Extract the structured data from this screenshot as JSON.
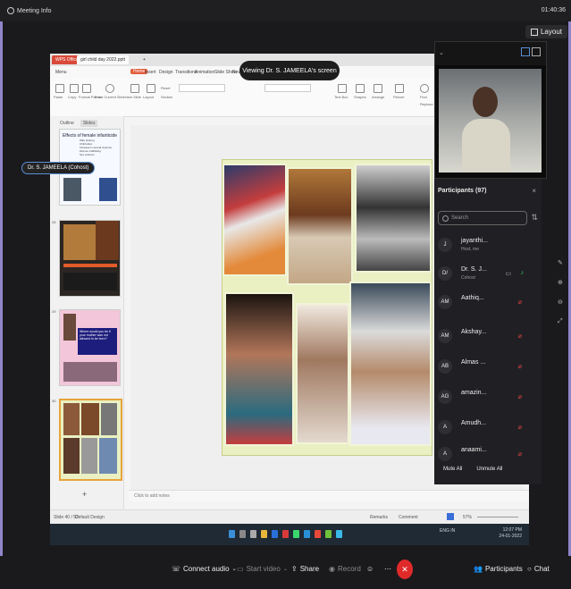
{
  "topbar": {
    "meeting_info": "Meeting Info",
    "time": "01:40:36"
  },
  "layout_button": "Layout",
  "viewing_banner": "Viewing Dr. S. JAMEELA's screen",
  "wps": {
    "tabs": [
      "WPS Office",
      "girl child day 2022.pptt"
    ],
    "menu": [
      "Menu",
      "Home",
      "Insert",
      "Design",
      "Transitions",
      "Animation",
      "Slide Show",
      "Review",
      "View"
    ],
    "ribbon_labels": [
      "Paste",
      "Copy",
      "Format Painter",
      "From Current Slide",
      "New Slide",
      "Layout",
      "Reset",
      "Section",
      "Text Box",
      "Shapes",
      "Arrange",
      "Picture",
      "Find",
      "Replace"
    ],
    "panel_tabs": [
      "Outline",
      "Slides"
    ],
    "thumb1_title": "Effects of female infanticide",
    "thumb1_lines": [
      "Wife sharing",
      "Child labor",
      "Increase in sexual violence",
      "Women trafficking",
      "Sex cultures"
    ],
    "thumb3_text": "Where would you be if your mother was not allowed to be born?",
    "thumb_numbers": [
      "28",
      "29",
      "30"
    ],
    "notes_placeholder": "Click to add notes",
    "status_left": "Slide 40 / 53",
    "status_design": "Default Design",
    "status_right": [
      "Remarks",
      "Comment"
    ],
    "zoom": "57%"
  },
  "taskbar": {
    "lang": "ENG IN",
    "time": "12:07 PM",
    "date": "24-01-2022"
  },
  "video": {
    "name": "Dr. S. JAMEELA (Cohost)"
  },
  "participants": {
    "title": "Participants (97)",
    "search_placeholder": "Search",
    "list": [
      {
        "initial": "J",
        "name": "jayanthi...",
        "sub": "Host, me"
      },
      {
        "initial": "D/",
        "name": "Dr. S. J...",
        "sub": "Cohost"
      },
      {
        "initial": "AM",
        "name": "Aathiq...",
        "sub": ""
      },
      {
        "initial": "AM",
        "name": "Akshay...",
        "sub": ""
      },
      {
        "initial": "AB",
        "name": "Almas ...",
        "sub": ""
      },
      {
        "initial": "AG",
        "name": "amazin...",
        "sub": ""
      },
      {
        "initial": "A",
        "name": "Amudh...",
        "sub": ""
      },
      {
        "initial": "A",
        "name": "anaami...",
        "sub": ""
      }
    ],
    "mute_all": "Mute All",
    "unmute_all": "Unmute All"
  },
  "controls": {
    "connect_audio": "Connect audio",
    "start_video": "Start video",
    "share": "Share",
    "record": "Record",
    "participants": "Participants",
    "chat": "Chat"
  }
}
